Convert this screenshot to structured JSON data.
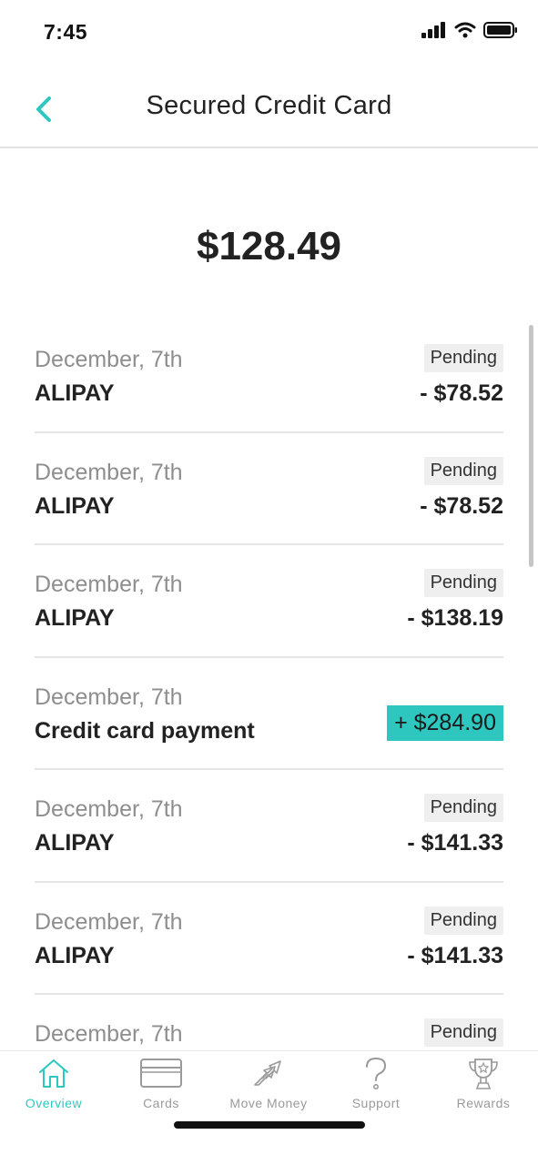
{
  "status_bar": {
    "time": "7:45"
  },
  "header": {
    "title": "Secured Credit Card"
  },
  "balance": "$128.49",
  "transactions": [
    {
      "date": "December, 7th",
      "merchant": "ALIPAY",
      "status": "Pending",
      "amount": "- $78.52"
    },
    {
      "date": "December, 7th",
      "merchant": "ALIPAY",
      "status": "Pending",
      "amount": "- $78.52"
    },
    {
      "date": "December, 7th",
      "merchant": "ALIPAY",
      "status": "Pending",
      "amount": "- $138.19"
    },
    {
      "date": "December, 7th",
      "merchant": "Credit card payment",
      "status": "",
      "amount": "+ $284.90"
    },
    {
      "date": "December, 7th",
      "merchant": "ALIPAY",
      "status": "Pending",
      "amount": "- $141.33"
    },
    {
      "date": "December, 7th",
      "merchant": "ALIPAY",
      "status": "Pending",
      "amount": "- $141.33"
    },
    {
      "date": "December, 7th",
      "merchant": "",
      "status": "Pending",
      "amount": ""
    }
  ],
  "tabs": [
    {
      "label": "Overview",
      "icon": "home-icon"
    },
    {
      "label": "Cards",
      "icon": "card-icon"
    },
    {
      "label": "Move Money",
      "icon": "transfer-arrows-icon"
    },
    {
      "label": "Support",
      "icon": "question-icon"
    },
    {
      "label": "Rewards",
      "icon": "trophy-icon"
    }
  ],
  "colors": {
    "accent": "#2ec7c0",
    "text": "#222222",
    "muted": "#8e8e8e",
    "badge_bg": "#efefef"
  }
}
